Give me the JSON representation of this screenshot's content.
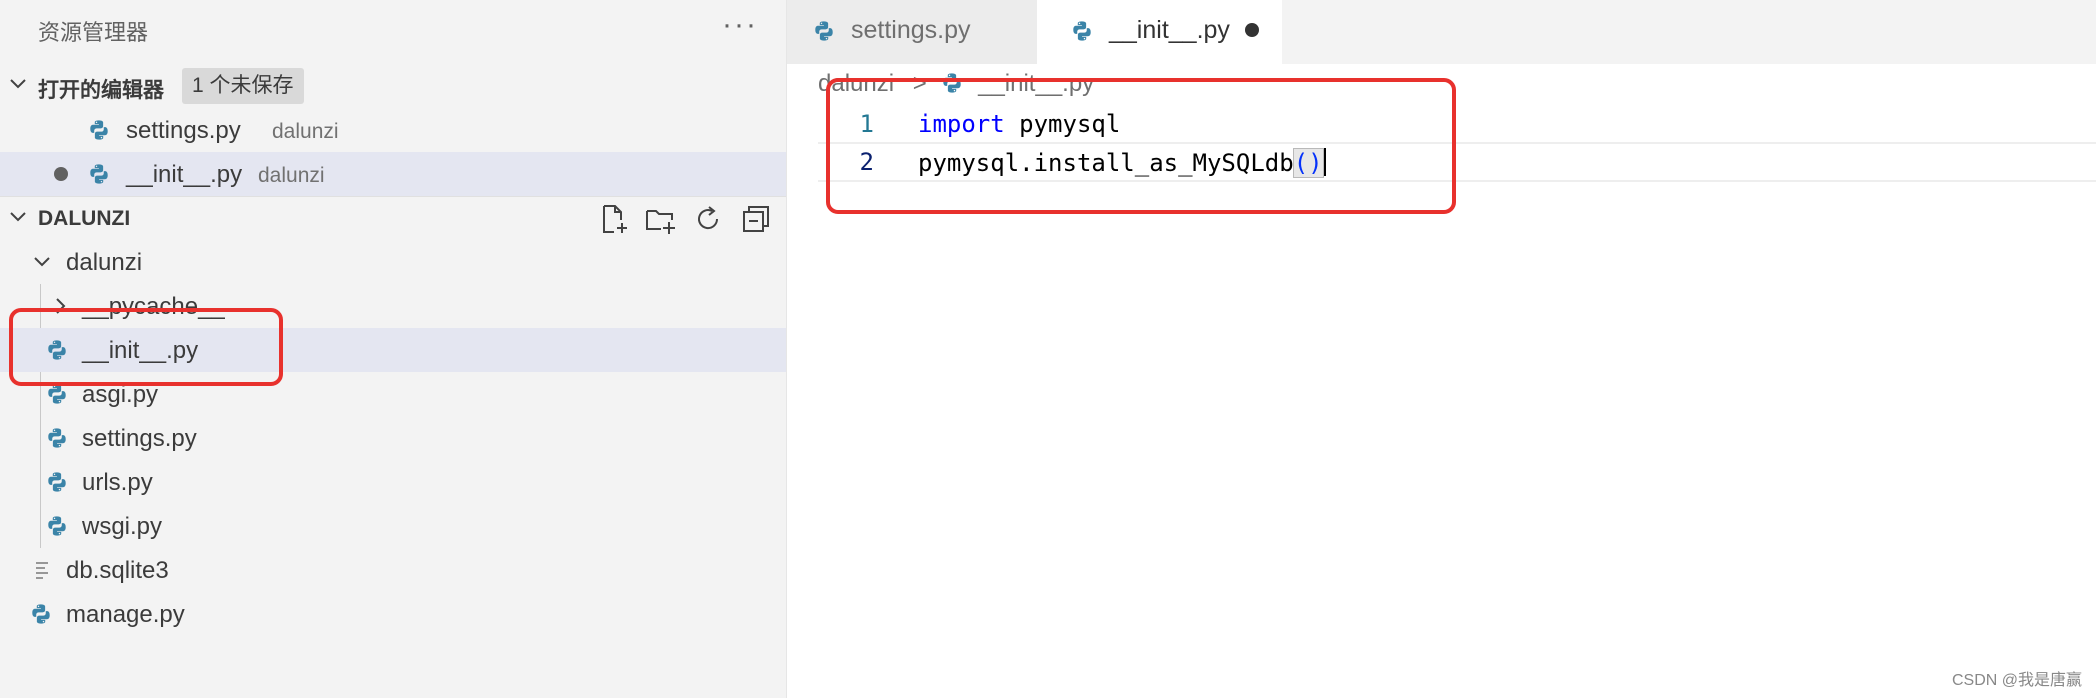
{
  "explorer": {
    "title": "资源管理器",
    "more_label": "···",
    "open_editors": {
      "label": "打开的编辑器",
      "badge": "1 个未保存",
      "items": [
        {
          "name": "settings.py",
          "folder": "dalunzi"
        },
        {
          "name": "__init__.py",
          "folder": "dalunzi"
        }
      ]
    },
    "project": {
      "label": "DALUNZI",
      "folder": "dalunzi",
      "children": [
        "__pycache__",
        "__init__.py",
        "asgi.py",
        "settings.py",
        "urls.py",
        "wsgi.py"
      ],
      "root_files": [
        "db.sqlite3",
        "manage.py"
      ]
    }
  },
  "tabs": [
    {
      "label": "settings.py"
    },
    {
      "label": "__init__.py"
    }
  ],
  "breadcrumb": {
    "folder": "dalunzi",
    "separator": ">",
    "file": "__init__.py"
  },
  "code": {
    "lines": [
      {
        "number": "1",
        "keyword": "import",
        "rest": " pymysql"
      },
      {
        "number": "2",
        "text": "pymysql.install_as_MySQLdb",
        "parens": "()"
      }
    ]
  },
  "watermark": "CSDN @我是唐赢",
  "colors": {
    "accent_red": "#e8312d",
    "python_icon": "#3b84a8",
    "keyword": "#0000ff"
  }
}
